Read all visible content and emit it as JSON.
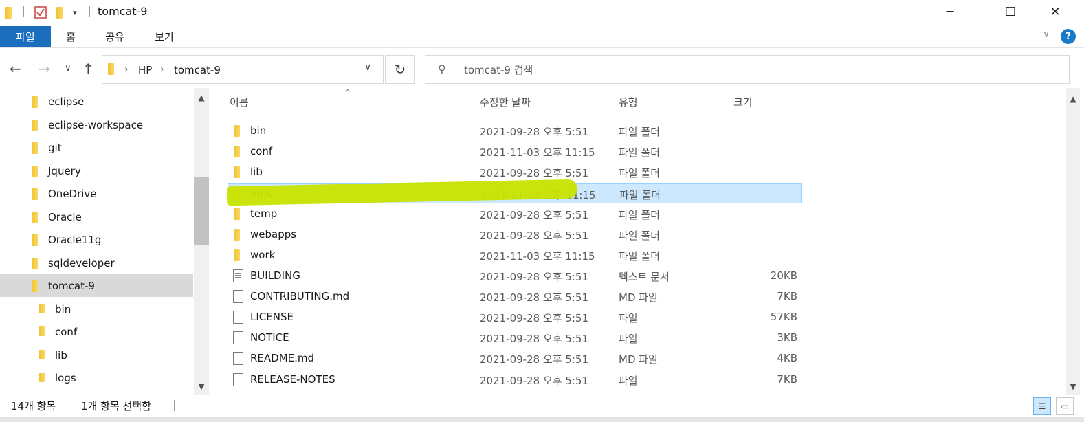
{
  "window": {
    "title": "tomcat-9",
    "minimize_icon": "minimize-icon",
    "maximize_icon": "maximize-icon",
    "close_icon": "close-icon",
    "minimize_glyph": "─",
    "maximize_glyph": "☐",
    "close_glyph": "✕"
  },
  "ribbon": {
    "tabs": [
      {
        "label": "파일"
      },
      {
        "label": "홈"
      },
      {
        "label": "공유"
      },
      {
        "label": "보기"
      }
    ],
    "help_glyph": "?",
    "collapse_glyph": "∨"
  },
  "navigation": {
    "back_glyph": "←",
    "forward_glyph": "→",
    "recent_glyph": "∨",
    "up_glyph": "↑",
    "breadcrumb": [
      "HP",
      "tomcat-9"
    ],
    "breadcrumb_sep": "›",
    "address_dropdown_glyph": "∨",
    "refresh_glyph": "↻",
    "search_placeholder": "tomcat-9 검색",
    "search_glyph": "⚲"
  },
  "sidebar": {
    "items": [
      {
        "label": "eclipse"
      },
      {
        "label": "eclipse-workspace"
      },
      {
        "label": "git"
      },
      {
        "label": "Jquery"
      },
      {
        "label": "OneDrive"
      },
      {
        "label": "Oracle"
      },
      {
        "label": "Oracle11g"
      },
      {
        "label": "sqldeveloper"
      },
      {
        "label": "tomcat-9"
      },
      {
        "label": "bin"
      },
      {
        "label": "conf"
      },
      {
        "label": "lib"
      },
      {
        "label": "logs"
      }
    ],
    "selected_index": 8
  },
  "file_list": {
    "columns": {
      "name": "이름",
      "date": "수정한 날짜",
      "type": "유형",
      "size": "크기"
    },
    "sort_glyph": "^",
    "rows": [
      {
        "name": "bin",
        "date": "2021-09-28 오후 5:51",
        "type": "파일 폴더",
        "size": ""
      },
      {
        "name": "conf",
        "date": "2021-11-03 오후 11:15",
        "type": "파일 폴더",
        "size": ""
      },
      {
        "name": "lib",
        "date": "2021-09-28 오후 5:51",
        "type": "파일 폴더",
        "size": ""
      },
      {
        "name": "logs",
        "date": "2021-11-03 오후 11:15",
        "type": "파일 폴더",
        "size": ""
      },
      {
        "name": "temp",
        "date": "2021-09-28 오후 5:51",
        "type": "파일 폴더",
        "size": ""
      },
      {
        "name": "webapps",
        "date": "2021-09-28 오후 5:51",
        "type": "파일 폴더",
        "size": ""
      },
      {
        "name": "work",
        "date": "2021-11-03 오후 11:15",
        "type": "파일 폴더",
        "size": ""
      },
      {
        "name": "BUILDING",
        "date": "2021-09-28 오후 5:51",
        "type": "텍스트 문서",
        "size": "20KB"
      },
      {
        "name": "CONTRIBUTING.md",
        "date": "2021-09-28 오후 5:51",
        "type": "MD 파일",
        "size": "7KB"
      },
      {
        "name": "LICENSE",
        "date": "2021-09-28 오후 5:51",
        "type": "파일",
        "size": "57KB"
      },
      {
        "name": "NOTICE",
        "date": "2021-09-28 오후 5:51",
        "type": "파일",
        "size": "3KB"
      },
      {
        "name": "README.md",
        "date": "2021-09-28 오후 5:51",
        "type": "MD 파일",
        "size": "4KB"
      },
      {
        "name": "RELEASE-NOTES",
        "date": "2021-09-28 오후 5:51",
        "type": "파일",
        "size": "7KB"
      }
    ],
    "selected_index": 3
  },
  "status": {
    "item_count": "14개 항목",
    "selected": "1개 항목 선택함",
    "details_view_glyph": "☰",
    "large_icon_view_glyph": "▭"
  },
  "colors": {
    "accent": "#1a6ebd",
    "selection": "#cce8ff",
    "highlight_marker": "#c8e400",
    "folder": "#f2c430"
  }
}
